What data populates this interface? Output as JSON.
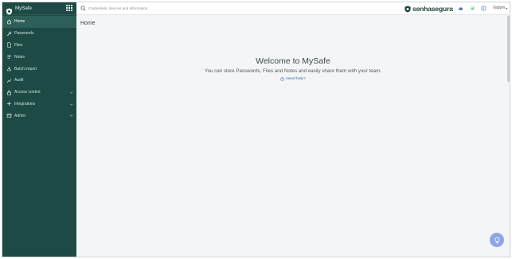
{
  "app": {
    "name": "MySafe",
    "brand": "senhasegura"
  },
  "topbar": {
    "search_placeholder": "Credentials, devices and information",
    "user": "Vadym"
  },
  "sidebar": {
    "items": [
      {
        "label": "Home",
        "icon": "home-icon",
        "active": true
      },
      {
        "label": "Passwords",
        "icon": "key-icon"
      },
      {
        "label": "Files",
        "icon": "file-icon"
      },
      {
        "label": "Notes",
        "icon": "notes-icon"
      },
      {
        "label": "Batch import",
        "icon": "import-icon"
      },
      {
        "label": "Audit",
        "icon": "audit-icon"
      },
      {
        "label": "Access control",
        "icon": "lock-icon",
        "expandable": true
      },
      {
        "label": "Integrations",
        "icon": "plus-icon",
        "expandable": true
      },
      {
        "label": "Admin",
        "icon": "admin-icon",
        "expandable": true
      }
    ]
  },
  "main": {
    "title": "Home",
    "welcome": "Welcome to MySafe",
    "subtitle": "You can store Passwords, Files and Notes and easily share them with your team.",
    "help_link": "Need help?"
  },
  "colors": {
    "sidebar_bg": "#1d4a44",
    "active_bg": "#2d5f58",
    "accent": "#3b6ea5",
    "fab": "#8fa6e6"
  }
}
